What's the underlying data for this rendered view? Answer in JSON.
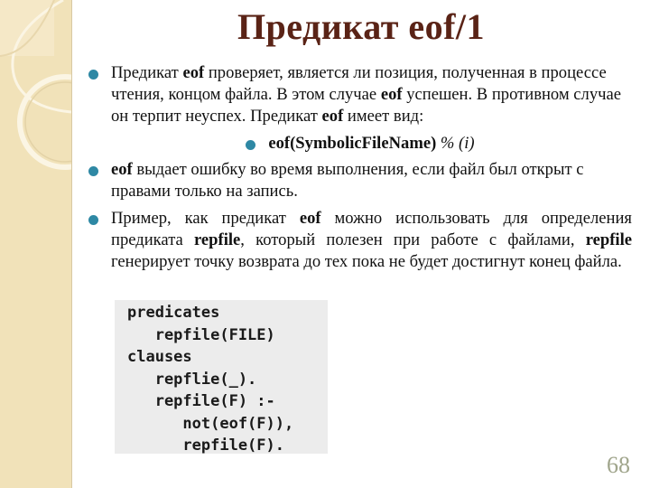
{
  "slide": {
    "title": "Предикат eof/1",
    "page_number": "68",
    "bullets": [
      {
        "parts": [
          {
            "text": "Предикат ",
            "bold": false
          },
          {
            "text": "eof",
            "bold": true
          },
          {
            "text": " проверяет, является ли позиция, полученная в процессе чтения, концом файла. В этом случае ",
            "bold": false
          },
          {
            "text": "eof",
            "bold": true
          },
          {
            "text": " успешен. В противном случае он терпит неуспех. Предикат ",
            "bold": false
          },
          {
            "text": "eof",
            "bold": true
          },
          {
            "text": " имеет вид:",
            "bold": false
          }
        ]
      },
      {
        "sub": true,
        "signature_bold": "eof(SymbolicFileName)",
        "signature_italic": " % (i)"
      },
      {
        "parts": [
          {
            "text": "eof",
            "bold": true
          },
          {
            "text": " выдает ошибку во время выполнения, если файл был открыт с правами только на запись.",
            "bold": false
          }
        ]
      },
      {
        "parts": [
          {
            "text": "Пример, как предикат ",
            "bold": false
          },
          {
            "text": "eof",
            "bold": true
          },
          {
            "text": " можно использовать для определения предиката ",
            "bold": false
          },
          {
            "text": "repfile",
            "bold": true
          },
          {
            "text": ", который полезен при работе с файлами, ",
            "bold": false
          },
          {
            "text": "repfile",
            "bold": true
          },
          {
            "text": " генерирует точку возврата до тех пока не будет достигнут конец файла.",
            "bold": false
          }
        ]
      }
    ],
    "code_lines": [
      "predicates",
      "   repfile(FILE)",
      "clauses",
      "   repflie(_).",
      "   repfile(F) :-",
      "      not(eof(F)),",
      "      repfile(F)."
    ]
  },
  "colors": {
    "title": "#5a2316",
    "bullet": "#2e88a4",
    "side_panel": "#f1e2b9",
    "code_background": "#ececec",
    "page_number": "#a0a58c"
  }
}
